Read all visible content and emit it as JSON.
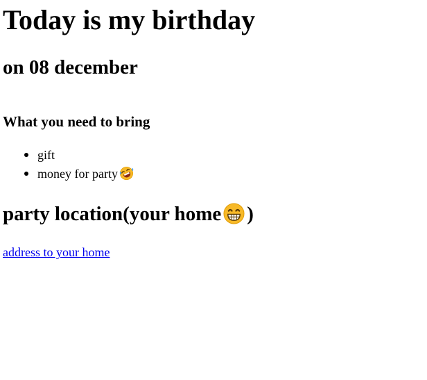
{
  "header": {
    "title": "Today is my birthday",
    "date_line": "on 08 december"
  },
  "bring": {
    "heading": "What you need to bring",
    "items": [
      {
        "label": "gift"
      },
      {
        "label": "money for party",
        "icon": "rolling-on-floor-laughing-emoji"
      }
    ]
  },
  "location": {
    "heading_prefix": "party location(your home",
    "heading_icon": "grinning-face-emoji",
    "heading_suffix": ")",
    "link_text": "address to your home"
  },
  "colors": {
    "link": "#0000ee",
    "emoji_yellow": "#f7b928"
  }
}
